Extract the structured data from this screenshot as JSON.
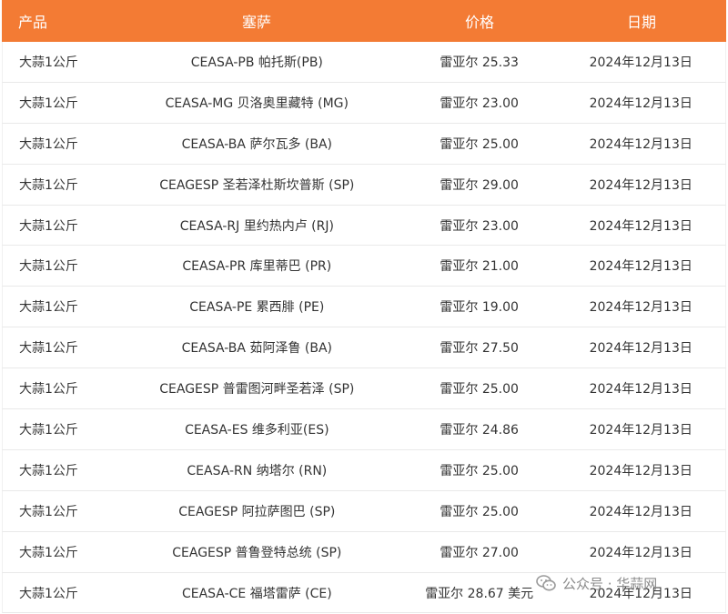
{
  "table": {
    "headers": [
      "产品",
      "塞萨",
      "价格",
      "日期"
    ],
    "rows": [
      [
        "大蒜1公斤",
        "CEASA-PB 帕托斯(PB)",
        "雷亚尔 25.33",
        "2024年12月13日"
      ],
      [
        "大蒜1公斤",
        "CEASA-MG 贝洛奥里藏特 (MG)",
        "雷亚尔 23.00",
        "2024年12月13日"
      ],
      [
        "大蒜1公斤",
        "CEASA-BA 萨尔瓦多 (BA)",
        "雷亚尔 25.00",
        "2024年12月13日"
      ],
      [
        "大蒜1公斤",
        "CEAGESP 圣若泽杜斯坎普斯 (SP)",
        "雷亚尔 29.00",
        "2024年12月13日"
      ],
      [
        "大蒜1公斤",
        "CEASA-RJ 里约热内卢 (RJ)",
        "雷亚尔 23.00",
        "2024年12月13日"
      ],
      [
        "大蒜1公斤",
        "CEASA-PR 库里蒂巴 (PR)",
        "雷亚尔 21.00",
        "2024年12月13日"
      ],
      [
        "大蒜1公斤",
        "CEASA-PE 累西腓 (PE)",
        "雷亚尔 19.00",
        "2024年12月13日"
      ],
      [
        "大蒜1公斤",
        "CEASA-BA 茹阿泽鲁 (BA)",
        "雷亚尔 27.50",
        "2024年12月13日"
      ],
      [
        "大蒜1公斤",
        "CEAGESP 普雷图河畔圣若泽 (SP)",
        "雷亚尔 25.00",
        "2024年12月13日"
      ],
      [
        "大蒜1公斤",
        "CEASA-ES 维多利亚(ES)",
        "雷亚尔 24.86",
        "2024年12月13日"
      ],
      [
        "大蒜1公斤",
        "CEASA-RN 纳塔尔 (RN)",
        "雷亚尔 25.00",
        "2024年12月13日"
      ],
      [
        "大蒜1公斤",
        "CEAGESP 阿拉萨图巴 (SP)",
        "雷亚尔 25.00",
        "2024年12月13日"
      ],
      [
        "大蒜1公斤",
        "CEAGESP 普鲁登特总统 (SP)",
        "雷亚尔 27.00",
        "2024年12月13日"
      ],
      [
        "大蒜1公斤",
        "CEASA-CE 福塔雷萨 (CE)",
        "雷亚尔 28.67 美元",
        "2024年12月13日"
      ]
    ]
  },
  "watermark": {
    "text": "公众号 · 华蒜网",
    "icon": "wechat-icon"
  },
  "colors": {
    "header_bg": "#f37b34",
    "header_text": "#ffffff",
    "row_text": "#333333",
    "divider": "#e9e9e9"
  }
}
